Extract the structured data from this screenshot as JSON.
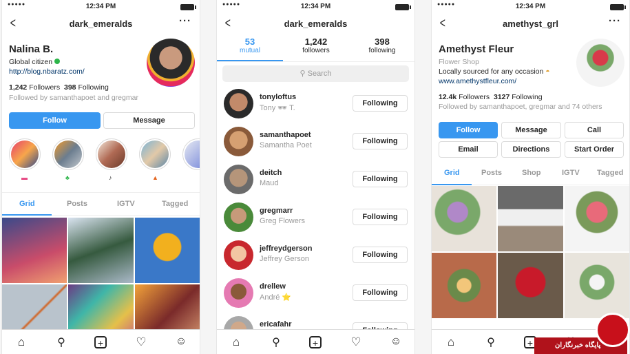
{
  "status": {
    "time": "12:34 PM",
    "signal": "●●●●●"
  },
  "p1": {
    "title": "dark_emeralds",
    "name": "Nalina B.",
    "bio": "Global citizen",
    "link": "http://blog.nbaratz.com/",
    "followers": "1,242",
    "followers_label": "Followers",
    "following": "398",
    "following_label": "Following",
    "followed_by": "Followed by samanthapoet and gregmar",
    "follow_btn": "Follow",
    "message_btn": "Message",
    "tabs": [
      "Grid",
      "Posts",
      "IGTV",
      "Tagged"
    ]
  },
  "p2": {
    "title": "dark_emeralds",
    "stats": [
      {
        "n": "53",
        "l": "mutual"
      },
      {
        "n": "1,242",
        "l": "followers"
      },
      {
        "n": "398",
        "l": "following"
      }
    ],
    "search": "Search",
    "list": [
      {
        "u": "tonyloftus",
        "f": "Tony 🕶 T."
      },
      {
        "u": "samanthapoet",
        "f": "Samantha Poet"
      },
      {
        "u": "deitch",
        "f": "Maud"
      },
      {
        "u": "gregmarr",
        "f": "Greg Flowers"
      },
      {
        "u": "jeffreydgerson",
        "f": "Jeffrey Gerson"
      },
      {
        "u": "drellew",
        "f": "André ⭐"
      },
      {
        "u": "ericafahr",
        "f": ""
      }
    ],
    "following_btn": "Following"
  },
  "p3": {
    "title": "amethyst_grl",
    "name": "Amethyst Fleur",
    "category": "Flower Shop",
    "bio": "Locally sourced for any occasion",
    "link": "www.amethystfleur.com/",
    "followers": "12.4k",
    "followers_label": "Followers",
    "following": "3127",
    "following_label": "Following",
    "followed_by": "Followed by samanthapoet, gregmar and 74 others",
    "buttons": [
      "Follow",
      "Message",
      "Call",
      "Email",
      "Directions",
      "Start Order"
    ],
    "tabs": [
      "Grid",
      "Posts",
      "Shop",
      "IGTV",
      "Tagged"
    ]
  },
  "watermark": "پایگاه خبرنگاران",
  "colors": {
    "accent": "#3897f0",
    "text": "#262626",
    "muted": "#999999"
  }
}
